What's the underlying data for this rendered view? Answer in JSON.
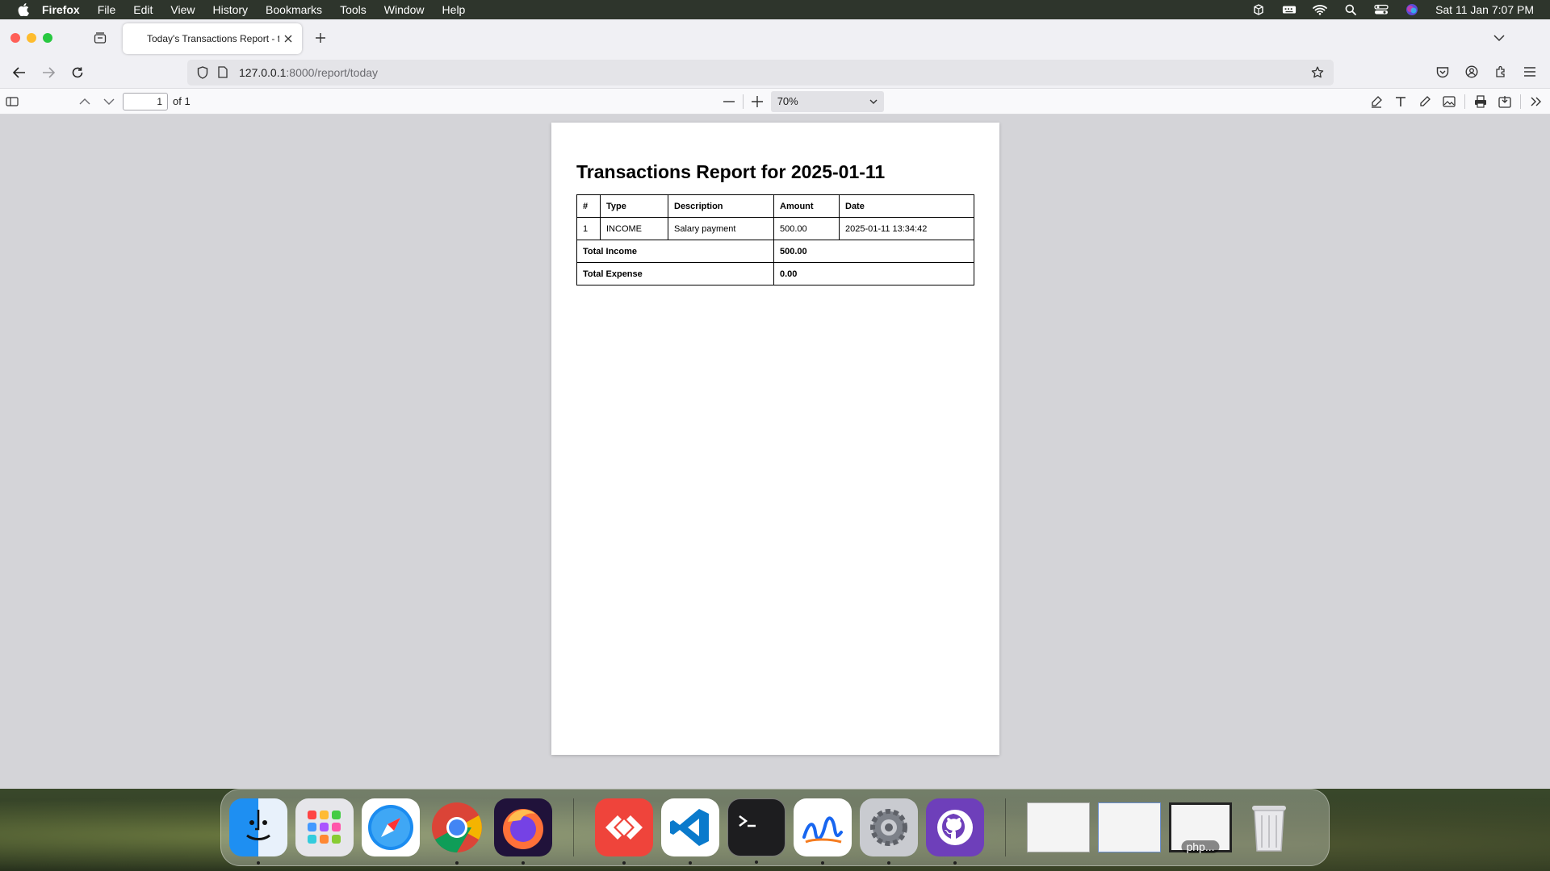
{
  "menubar": {
    "app": "Firefox",
    "items": [
      "File",
      "Edit",
      "View",
      "History",
      "Bookmarks",
      "Tools",
      "Window",
      "Help"
    ],
    "clock": "Sat 11 Jan  7:07 PM"
  },
  "browser": {
    "tab_title": "Today's Transactions Report - t",
    "url_host": "127.0.0.1",
    "url_path": ":8000/report/today"
  },
  "pdf_toolbar": {
    "page_number": "1",
    "page_count": "of 1",
    "zoom": "70%"
  },
  "report": {
    "title": "Transactions Report for 2025-01-11",
    "headers": [
      "#",
      "Type",
      "Description",
      "Amount",
      "Date"
    ],
    "rows": [
      {
        "num": "1",
        "type": "INCOME",
        "description": "Salary payment",
        "amount": "500.00",
        "date": "2025-01-11 13:34:42"
      }
    ],
    "total_income_label": "Total Income",
    "total_income_value": "500.00",
    "total_expense_label": "Total Expense",
    "total_expense_value": "0.00"
  },
  "dock": {
    "apps": [
      "Finder",
      "Launchpad",
      "Safari",
      "Chrome",
      "Firefox",
      "AnyDesk",
      "Visual Studio Code",
      "Terminal",
      "Freeform",
      "System Settings",
      "GitHub Desktop"
    ],
    "minimized_label": "php..."
  }
}
